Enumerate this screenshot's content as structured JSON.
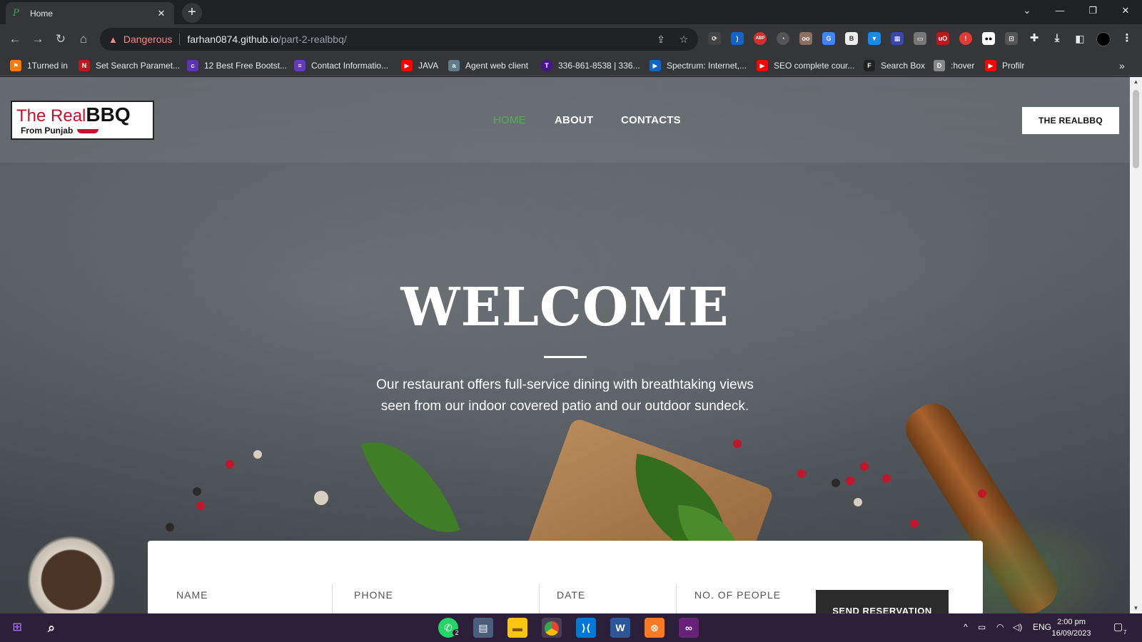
{
  "browser": {
    "tab": {
      "title": "Home"
    },
    "address": {
      "security_label": "Dangerous",
      "host": "farhan0874.github.io",
      "path": "/part-2-realbbq/"
    },
    "bookmarks": [
      {
        "label": "1Turned in",
        "icon": "bookmark-icon",
        "color": "#f57c00"
      },
      {
        "label": "Set Search Paramet...",
        "icon": "ns-icon",
        "color": "#b71c1c"
      },
      {
        "label": "12 Best Free Bootst...",
        "icon": "colorlib-icon",
        "color": "#5e35b1"
      },
      {
        "label": "Contact Informatio...",
        "icon": "form-icon",
        "color": "#673ab7"
      },
      {
        "label": "JAVA",
        "icon": "youtube-icon",
        "color": "#ff0000"
      },
      {
        "label": "Agent web client",
        "icon": "agent-icon",
        "color": "#607d8b"
      },
      {
        "label": "336-861-8538 | 336...",
        "icon": "t-icon",
        "color": "#4a148c"
      },
      {
        "label": "Spectrum: Internet,...",
        "icon": "spectrum-icon",
        "color": "#1565c0"
      },
      {
        "label": "SEO complete cour...",
        "icon": "youtube-icon",
        "color": "#ff0000"
      },
      {
        "label": "Search Box",
        "icon": "f-icon",
        "color": "#222222"
      },
      {
        "label": ":hover",
        "icon": "dg-icon",
        "color": "#888888"
      },
      {
        "label": "Profilr",
        "icon": "youtube-icon",
        "color": "#ff0000"
      }
    ]
  },
  "site": {
    "logo": {
      "line1_red": "The Real",
      "line1_black": "BBQ",
      "line2": "From Punjab"
    },
    "nav": [
      {
        "label": "HOME",
        "active": true
      },
      {
        "label": "ABOUT",
        "active": false
      },
      {
        "label": "CONTACTS",
        "active": false
      }
    ],
    "cta_label": "THE REALBBQ",
    "hero": {
      "title": "WELCOME",
      "text": "Our restaurant offers full-service dining with breathtaking views seen from our indoor covered patio and our outdoor sundeck."
    },
    "form": {
      "name_label": "NAME",
      "phone_label": "PHONE",
      "date_label": "DATE",
      "people_label": "NO. OF PEOPLE",
      "submit_label": "SEND RESERVATION"
    }
  },
  "taskbar": {
    "whatsapp_badge": "2",
    "language": "ENG",
    "time": "2:00 pm",
    "date": "16/09/2023",
    "notification_count": "7"
  },
  "colors": {
    "nav_active": "#4caf50",
    "danger": "#f28b82",
    "taskbar": "#2c1f3a"
  }
}
